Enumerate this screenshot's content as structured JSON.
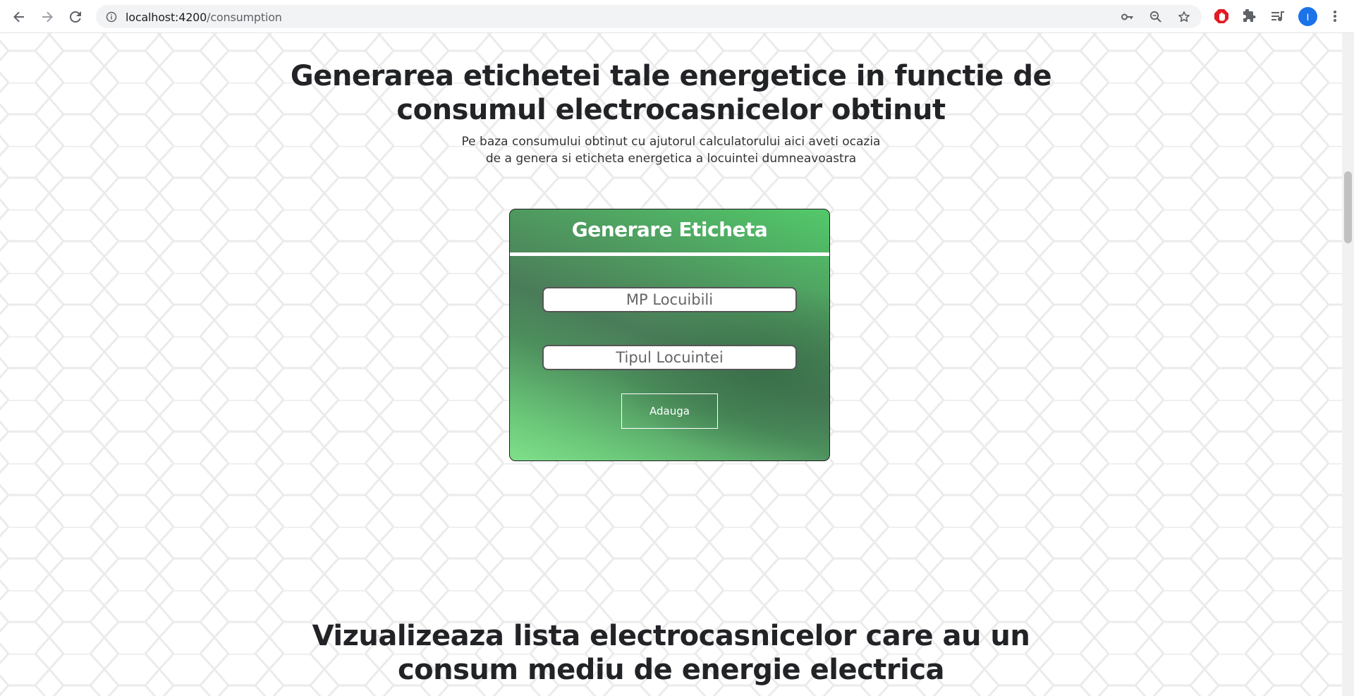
{
  "browser": {
    "url_host": "localhost:4200",
    "url_path": "/consumption",
    "avatar_letter": "I",
    "icons": [
      "back-icon",
      "forward-icon",
      "reload-icon",
      "site-info-icon",
      "key-icon",
      "zoom-icon",
      "star-icon",
      "adblock-icon",
      "extensions-icon",
      "reading-list-icon",
      "menu-icon"
    ]
  },
  "section1": {
    "title_line1": "Generarea etichetei tale energetice in functie de",
    "title_line2": "consumul electrocasnicelor obtinut",
    "subtitle_line1": "Pe baza consumului obtinut cu ajutorul calculatorului aici aveti ocazia",
    "subtitle_line2": "de a genera si eticheta energetica a locuintei dumneavoastra"
  },
  "card": {
    "title": "Generare Eticheta",
    "field1_placeholder": "MP Locuibili",
    "field2_placeholder": "Tipul Locuintei",
    "button_label": "Adauga"
  },
  "section2": {
    "title_line1": "Vizualizeaza lista electrocasnicelor care au un",
    "title_line2": "consum mediu de energie electrica"
  },
  "colors": {
    "accent_green": "#4a7c59",
    "light_green": "#52c96a",
    "heading_text": "#222326"
  }
}
